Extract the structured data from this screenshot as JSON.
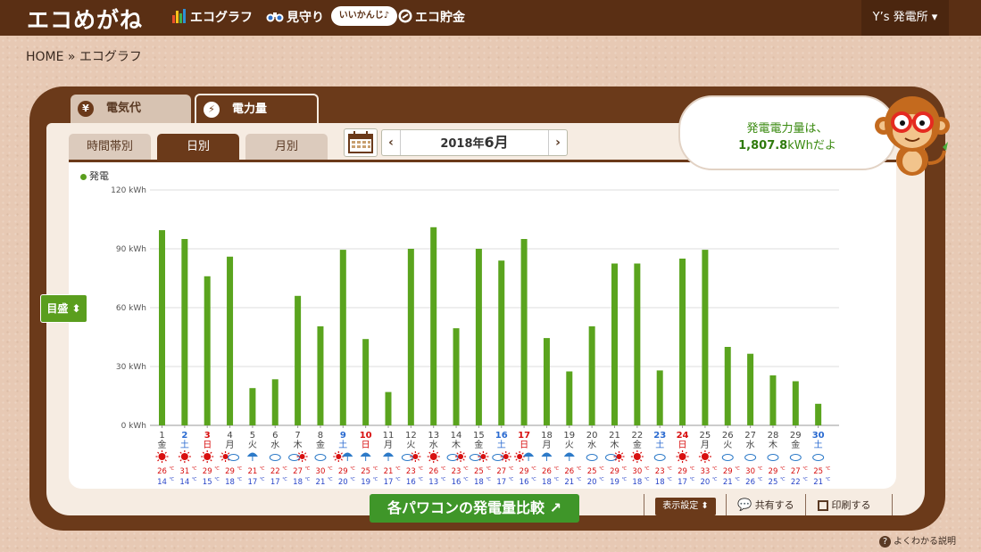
{
  "header": {
    "logo": "エコめがね",
    "nav": [
      {
        "label": "エコグラフ",
        "icon": "bar-chart-icon"
      },
      {
        "label": "見守り",
        "icon": "binoculars-icon"
      },
      {
        "label": "エコ貯金",
        "icon": "coin-icon"
      }
    ],
    "badge": "いいかんじ♪",
    "user_menu": "Y’s 発電所 ▾"
  },
  "breadcrumb": "HOME » エコグラフ",
  "tabs": {
    "cost": "電気代",
    "cost_icon": "¥",
    "power": "電力量",
    "power_icon": "⚡"
  },
  "period_tabs": [
    "時間帯別",
    "日別",
    "月別"
  ],
  "date_nav": {
    "year": "2018年",
    "month": "6月",
    "prev": "‹",
    "next": "›"
  },
  "speech": {
    "line1": "発電電力量は、",
    "value": "1,807.8",
    "unit": "kWhだよ"
  },
  "legend": "発電",
  "scale_button": "目盛 ⬍",
  "colors": {
    "bar": "#5aa41e",
    "sun": "#d81010",
    "rain": "#2d7ac8",
    "high": "#d81010",
    "low": "#2a46c8"
  },
  "chart_data": {
    "type": "bar",
    "ylabel": "kWh",
    "ylim": [
      0,
      120
    ],
    "yticks": [
      "0 kWh",
      "30 kWh",
      "60 kWh",
      "90 kWh",
      "120 kWh"
    ],
    "series": [
      {
        "name": "発電",
        "values": [
          99.5,
          95,
          76,
          86,
          19,
          23.5,
          66,
          50.5,
          89.5,
          44,
          17,
          90,
          101,
          49.5,
          90,
          84,
          95,
          44.5,
          27.5,
          50.5,
          82.5,
          82.5,
          28,
          85,
          89.5,
          40,
          36.5,
          25.5,
          22.5,
          11
        ]
      }
    ],
    "days": [
      {
        "d": "1",
        "w": "金",
        "t": "n",
        "wx": "sun",
        "hi": "26",
        "lo": "14"
      },
      {
        "d": "2",
        "w": "土",
        "t": "sat",
        "wx": "sun",
        "hi": "31",
        "lo": "14"
      },
      {
        "d": "3",
        "w": "日",
        "t": "sun",
        "wx": "sun",
        "hi": "29",
        "lo": "15"
      },
      {
        "d": "4",
        "w": "月",
        "t": "n",
        "wx": "suncloud",
        "hi": "29",
        "lo": "18"
      },
      {
        "d": "5",
        "w": "火",
        "t": "n",
        "wx": "rain",
        "hi": "21",
        "lo": "17"
      },
      {
        "d": "6",
        "w": "水",
        "t": "n",
        "wx": "cloud",
        "hi": "22",
        "lo": "17"
      },
      {
        "d": "7",
        "w": "木",
        "t": "n",
        "wx": "cloudsun",
        "hi": "27",
        "lo": "18"
      },
      {
        "d": "8",
        "w": "金",
        "t": "n",
        "wx": "cloud",
        "hi": "30",
        "lo": "21"
      },
      {
        "d": "9",
        "w": "土",
        "t": "sat",
        "wx": "sunrain",
        "hi": "29",
        "lo": "20"
      },
      {
        "d": "10",
        "w": "日",
        "t": "sun",
        "wx": "rain",
        "hi": "25",
        "lo": "19"
      },
      {
        "d": "11",
        "w": "月",
        "t": "n",
        "wx": "rain",
        "hi": "21",
        "lo": "17"
      },
      {
        "d": "12",
        "w": "火",
        "t": "n",
        "wx": "cloudsun",
        "hi": "23",
        "lo": "16"
      },
      {
        "d": "13",
        "w": "水",
        "t": "n",
        "wx": "sun",
        "hi": "26",
        "lo": "13"
      },
      {
        "d": "14",
        "w": "木",
        "t": "n",
        "wx": "cloudsun",
        "hi": "23",
        "lo": "16"
      },
      {
        "d": "15",
        "w": "金",
        "t": "n",
        "wx": "cloudsun",
        "hi": "25",
        "lo": "18"
      },
      {
        "d": "16",
        "w": "土",
        "t": "sat",
        "wx": "cloudsun",
        "hi": "27",
        "lo": "17"
      },
      {
        "d": "17",
        "w": "日",
        "t": "sun",
        "wx": "sunrain",
        "hi": "29",
        "lo": "16"
      },
      {
        "d": "18",
        "w": "月",
        "t": "n",
        "wx": "rain",
        "hi": "26",
        "lo": "18"
      },
      {
        "d": "19",
        "w": "火",
        "t": "n",
        "wx": "rain",
        "hi": "26",
        "lo": "21"
      },
      {
        "d": "20",
        "w": "水",
        "t": "n",
        "wx": "cloud",
        "hi": "25",
        "lo": "20"
      },
      {
        "d": "21",
        "w": "木",
        "t": "n",
        "wx": "cloudsun",
        "hi": "29",
        "lo": "19"
      },
      {
        "d": "22",
        "w": "金",
        "t": "n",
        "wx": "sun",
        "hi": "30",
        "lo": "18"
      },
      {
        "d": "23",
        "w": "土",
        "t": "sat",
        "wx": "cloud",
        "hi": "23",
        "lo": "18"
      },
      {
        "d": "24",
        "w": "日",
        "t": "sun",
        "wx": "sun",
        "hi": "29",
        "lo": "17"
      },
      {
        "d": "25",
        "w": "月",
        "t": "n",
        "wx": "sun",
        "hi": "33",
        "lo": "20"
      },
      {
        "d": "26",
        "w": "火",
        "t": "n",
        "wx": "cloud",
        "hi": "29",
        "lo": "21"
      },
      {
        "d": "27",
        "w": "水",
        "t": "n",
        "wx": "cloud",
        "hi": "30",
        "lo": "26"
      },
      {
        "d": "28",
        "w": "木",
        "t": "n",
        "wx": "cloud",
        "hi": "29",
        "lo": "25"
      },
      {
        "d": "29",
        "w": "金",
        "t": "n",
        "wx": "cloud",
        "hi": "27",
        "lo": "22"
      },
      {
        "d": "30",
        "w": "土",
        "t": "sat",
        "wx": "cloud",
        "hi": "25",
        "lo": "21"
      }
    ],
    "temp_unit": "℃"
  },
  "bottom": {
    "compare": "各パワコンの発電量比較",
    "display": "表示設定 ⬍",
    "share": "共有する",
    "print": "印刷する",
    "help": "よくわかる説明"
  }
}
